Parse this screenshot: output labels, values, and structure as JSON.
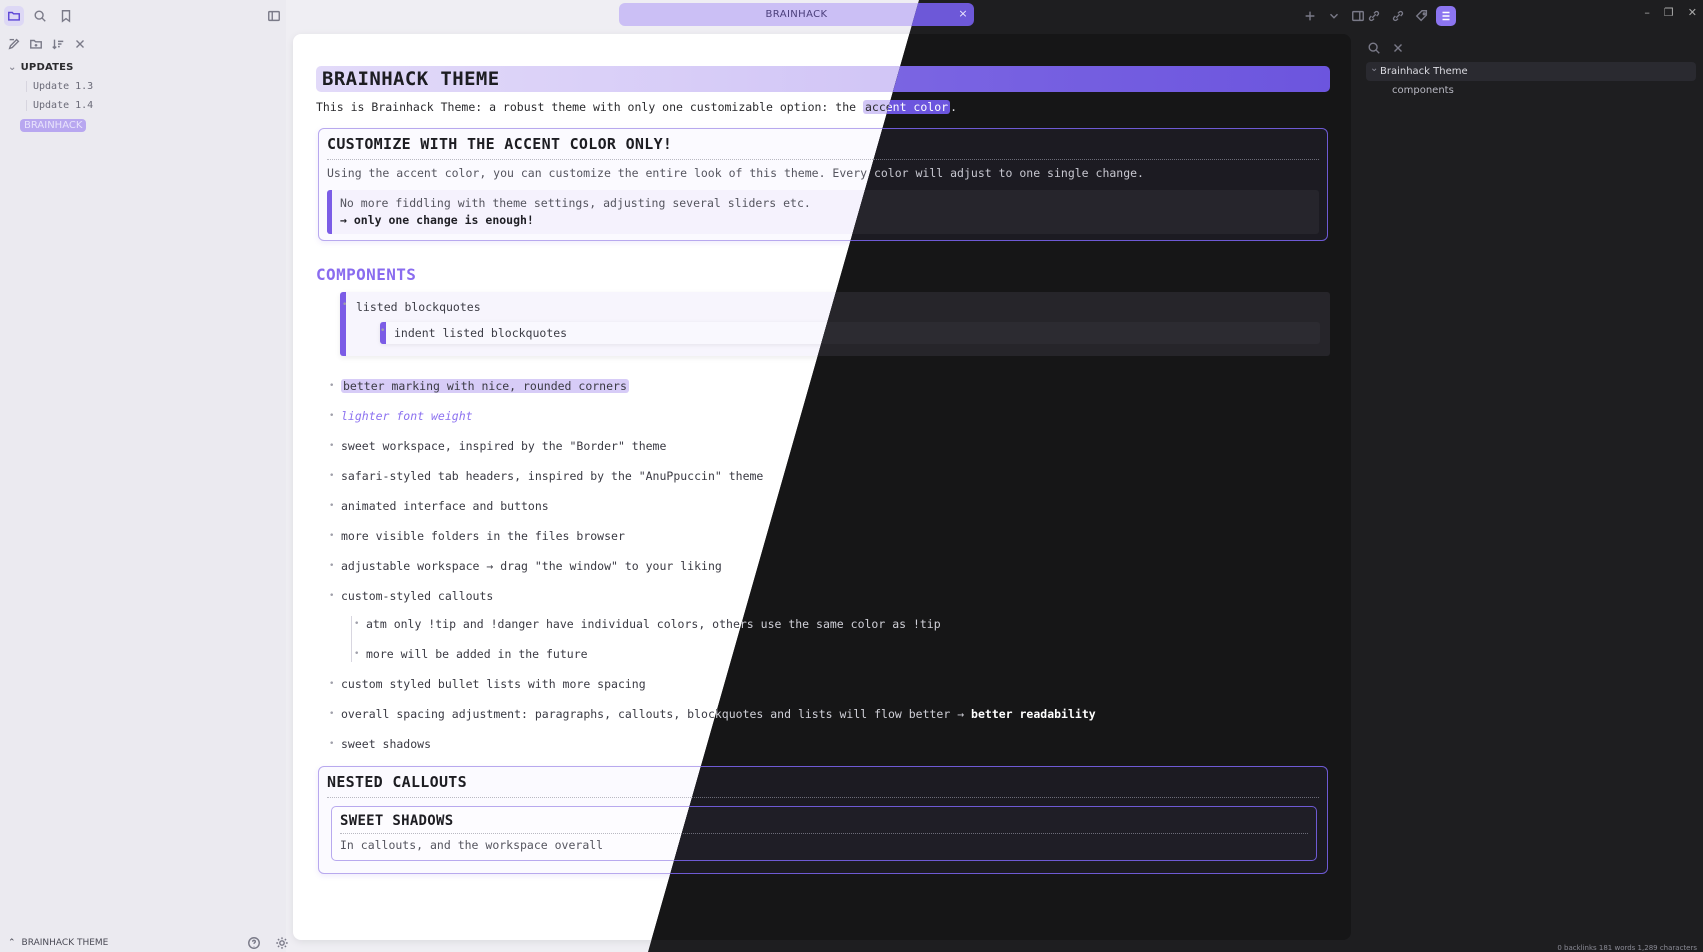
{
  "app": {
    "tab_title": "BRAINHACK",
    "tab_close": "×",
    "accent": "#7b5ce6"
  },
  "sidebar": {
    "top_icons": [
      "folder-icon",
      "search-icon",
      "bookmark-icon"
    ],
    "nav_icons": [
      "new-note-icon",
      "new-folder-icon",
      "sort-icon",
      "collapse-icon"
    ],
    "folder": "UPDATES",
    "files": [
      "Update 1.3",
      "Update 1.4"
    ],
    "active_file": "BRAINHACK"
  },
  "statusbar": {
    "vault_name": "BRAINHACK THEME",
    "right_text": "0 backlinks   181 words 1,289 characters"
  },
  "doc": {
    "title": "BRAINHACK THEME",
    "intro_pre": "This is Brainhack Theme: a robust theme with only one customizable option: the ",
    "intro_mark": "accent color",
    "intro_post": ".",
    "callout1": {
      "title": "CUSTOMIZE WITH THE ACCENT COLOR ONLY!",
      "body": "Using the accent color, you can customize the entire look of this theme. Every color will adjust to one single change.",
      "quote_line1": "No more fiddling with theme settings, adjusting several sliders etc.",
      "quote_line2": "→ only one change is enough!"
    },
    "components_heading": "COMPONENTS",
    "bq_item": "listed blockquotes",
    "bq_inner": "indent listed blockquotes",
    "features": [
      "better marking with nice, rounded corners",
      "lighter font weight",
      "sweet workspace, inspired by the \"Border\" theme",
      "safari-styled tab headers, inspired by the \"AnuPpuccin\" theme",
      "animated interface and buttons",
      "more visible folders in the files browser",
      "adjustable workspace → drag \"the window\" to your liking",
      "custom-styled callouts"
    ],
    "callout_sub": [
      "atm only !tip and !danger have individual colors, others use the same color as !tip",
      "more will be added in the future"
    ],
    "features2": [
      "custom styled bullet lists with more spacing"
    ],
    "spacing_pre": "overall spacing adjustment: paragraphs, callouts, blockquotes and lists will flow better → ",
    "spacing_bold": "better readability",
    "shadows": "sweet shadows",
    "nested_title": "NESTED CALLOUTS",
    "inner_title": "SWEET SHADOWS",
    "inner_body": "In callouts, and the workspace overall"
  },
  "outline": {
    "root": "Brainhack Theme",
    "child": "components"
  },
  "window": {
    "minimize": "–",
    "maximize": "❐",
    "close": "✕"
  }
}
